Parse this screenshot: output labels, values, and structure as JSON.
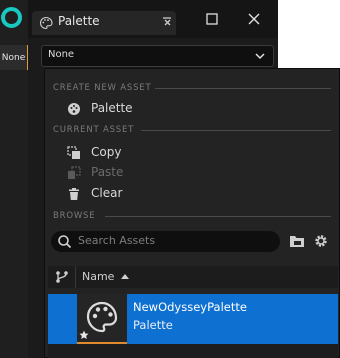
{
  "host": {
    "none_tag": "None"
  },
  "window": {
    "tab_title": "Palette",
    "combo_value": "None"
  },
  "menu": {
    "section_create": "CREATE NEW ASSET",
    "item_palette": "Palette",
    "section_current": "CURRENT ASSET",
    "item_copy": "Copy",
    "item_paste": "Paste",
    "item_clear": "Clear",
    "section_browse": "BROWSE",
    "search_placeholder": "Search Assets",
    "column_name": "Name",
    "asset_name": "NewOdysseyPalette",
    "asset_type": "Palette"
  },
  "colors": {
    "accent_teal": "#19c8c0",
    "selection_blue": "#0e70d0",
    "asset_underline": "#e08a2e"
  },
  "icons": [
    "palette-icon",
    "pin-icon",
    "maximize-icon",
    "close-icon",
    "chevron-down-icon",
    "copy-icon",
    "paste-icon",
    "trash-icon",
    "search-icon",
    "folder-icon",
    "gear-icon",
    "filter-icon",
    "sort-ascending-icon",
    "star-icon"
  ]
}
